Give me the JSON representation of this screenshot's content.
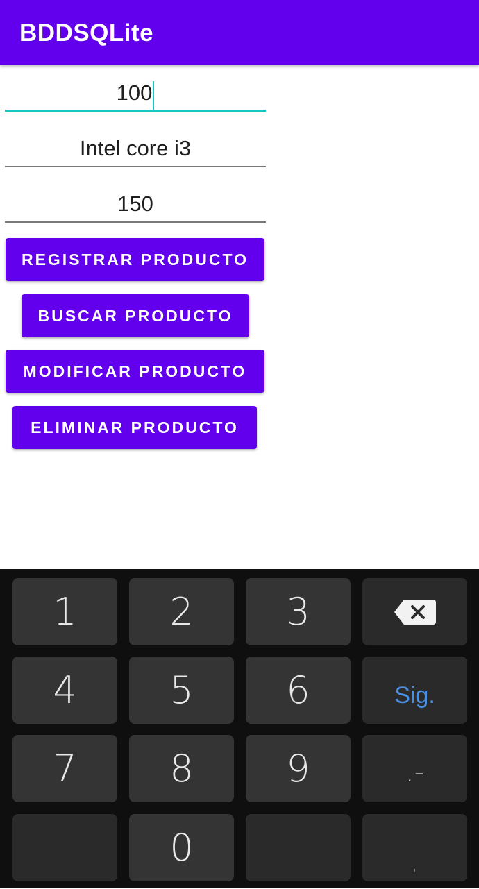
{
  "app": {
    "title": "BDDSQLite"
  },
  "form": {
    "codigo_value": "100",
    "descripcion_value": "Intel core i3",
    "precio_value": "150"
  },
  "buttons": {
    "registrar": "REGISTRAR PRODUCTO",
    "buscar": "BUSCAR PRODUCTO",
    "modificar": "MODIFICAR PRODUCTO",
    "eliminar": "ELIMINAR PRODUCTO"
  },
  "keyboard": {
    "keys": [
      "1",
      "2",
      "3",
      "4",
      "5",
      "6",
      "7",
      "8",
      "9",
      "0"
    ],
    "next_label": "Sig.",
    "punct_label": ".-",
    "comma_label": ","
  },
  "colors": {
    "primary": "#6200ee",
    "accent": "#18c7c0",
    "keyboard_bg": "#0f0f0f",
    "key_bg": "#343434",
    "next_key_text": "#4a90e2"
  }
}
